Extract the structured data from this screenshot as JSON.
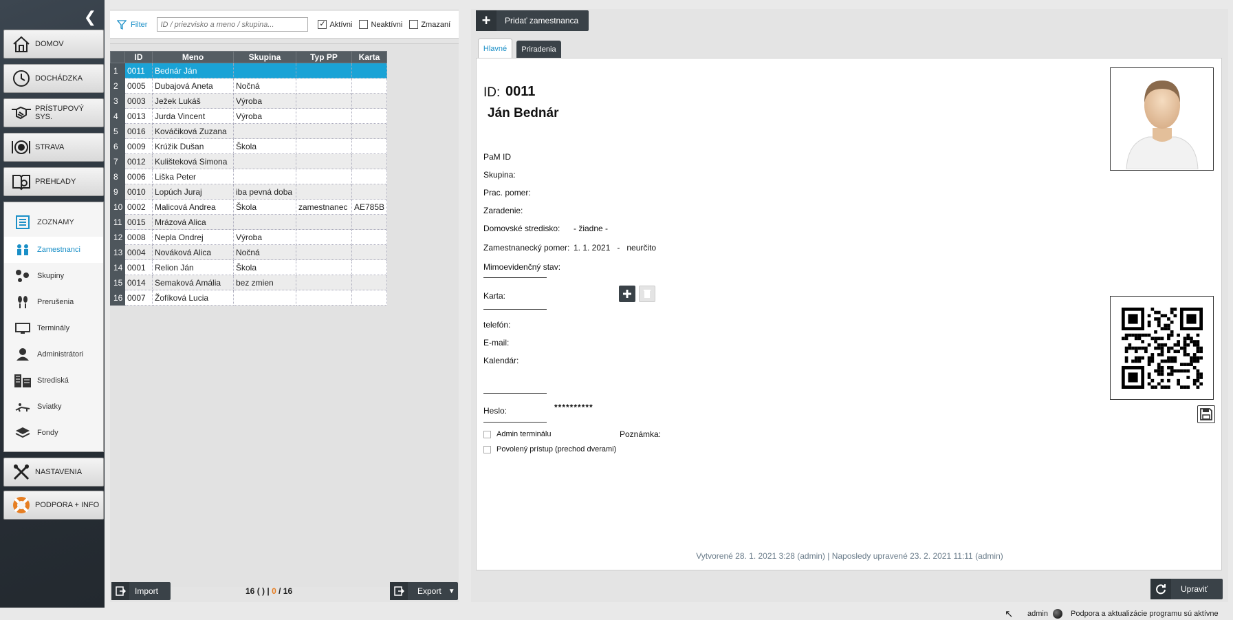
{
  "sidebar": {
    "collapse_glyph": "❮",
    "menu": [
      {
        "label": "DOMOV",
        "icon": "home-icon"
      },
      {
        "label": "DOCHÁDZKA",
        "icon": "clock-icon"
      },
      {
        "label": "PRÍSTUPOVÝ SYS.",
        "icon": "handshake-icon"
      },
      {
        "label": "STRAVA",
        "icon": "plate-icon"
      },
      {
        "label": "PREHĽADY",
        "icon": "report-book-icon"
      }
    ],
    "submenu_header": "ZOZNAMY",
    "submenu": [
      {
        "label": "Zamestnanci",
        "icon": "people-icon"
      },
      {
        "label": "Skupiny",
        "icon": "group-icon"
      },
      {
        "label": "Prerušenia",
        "icon": "footprints-icon"
      },
      {
        "label": "Terminály",
        "icon": "terminal-icon"
      },
      {
        "label": "Administrátori",
        "icon": "admin-icon"
      },
      {
        "label": "Strediská",
        "icon": "buildings-icon"
      },
      {
        "label": "Sviatky",
        "icon": "holiday-icon"
      },
      {
        "label": "Fondy",
        "icon": "layers-icon"
      }
    ],
    "bottom": [
      {
        "label": "NASTAVENIA",
        "icon": "tools-icon"
      },
      {
        "label": "PODPORA + INFO",
        "icon": "lifebuoy-icon"
      }
    ]
  },
  "filter": {
    "label": "Filter",
    "placeholder": "ID / priezvisko a meno / skupina...",
    "active_label": "Aktívni",
    "active_checked": "✓",
    "inactive_label": "Neaktívni",
    "deleted_label": "Zmazaní"
  },
  "table": {
    "columns": [
      "ID",
      "Meno",
      "Skupina",
      "Typ PP",
      "Karta"
    ],
    "rows": [
      [
        "1",
        "0011",
        "Bednár Ján",
        "",
        "",
        ""
      ],
      [
        "2",
        "0005",
        "Dubajová Aneta",
        "Nočná",
        "",
        ""
      ],
      [
        "3",
        "0003",
        "Ježek Lukáš",
        "Výroba",
        "",
        ""
      ],
      [
        "4",
        "0013",
        "Jurda Vincent",
        "Výroba",
        "",
        ""
      ],
      [
        "5",
        "0016",
        "Kováčiková Zuzana",
        "",
        "",
        ""
      ],
      [
        "6",
        "0009",
        "Krúžik Dušan",
        "Škola",
        "",
        ""
      ],
      [
        "7",
        "0012",
        "Kulišteková Simona",
        "",
        "",
        ""
      ],
      [
        "8",
        "0006",
        "Liška Peter",
        "",
        "",
        ""
      ],
      [
        "9",
        "0010",
        "Lopúch Juraj",
        "iba pevná doba",
        "",
        ""
      ],
      [
        "10",
        "0002",
        "Malicová Andrea",
        "Škola",
        "zamestnanec",
        "AE785B"
      ],
      [
        "11",
        "0015",
        "Mrázová Alica",
        "",
        "",
        ""
      ],
      [
        "12",
        "0008",
        "Nepla Ondrej",
        "Výroba",
        "",
        ""
      ],
      [
        "13",
        "0004",
        "Nováková Alica",
        "Nočná",
        "",
        ""
      ],
      [
        "14",
        "0001",
        "Relion Ján",
        "Škola",
        "",
        ""
      ],
      [
        "15",
        "0014",
        "Semaková Amália",
        "bez zmien",
        "",
        ""
      ],
      [
        "16",
        "0007",
        "Žofíková Lucia",
        "",
        "",
        ""
      ]
    ]
  },
  "bottom_bar": {
    "import_label": "Import",
    "count_total": "16",
    "count_open": " ( ",
    "count_close": " ) | ",
    "count_selected": "0",
    "count_sep": " / ",
    "count_of": "16",
    "export_label": "Export"
  },
  "detail": {
    "add_label": "Pridať zamestnanca",
    "tabs": [
      "Hlavné",
      "Priradenia"
    ],
    "id_label": "ID:",
    "id_value": "0011",
    "name": "Ján Bednár",
    "fields": {
      "pam_id": "PaM ID",
      "skupina": "Skupina:",
      "prac_pomer": "Prac. pomer:",
      "zaradenie": "Zaradenie:",
      "stredisko_label": "Domovské stredisko:",
      "stredisko_value": "- žiadne -",
      "zam_pomer_label": "Zamestnanecký pomer:",
      "zam_pomer_value": "1. 1. 2021   -   neurčito",
      "mimoevid": "Mimoevidenčný stav:",
      "karta": "Karta:",
      "telefon": "telefón:",
      "email": "E-mail:",
      "kalendar": "Kalendár:",
      "heslo": "Heslo:",
      "heslo_value": "**********",
      "admin_term": "Admin terminálu",
      "povoleny": "Povolený prístup (prechod dverami)",
      "poznamka": "Poznámka:"
    },
    "footer": "Vytvorené 28. 1. 2021 3:28 (admin) | Naposledy upravené 23. 2. 2021 11:11 (admin)",
    "edit_label": "Upraviť"
  },
  "status": {
    "user": "admin",
    "message": "Podpora a aktualizácie programu sú aktívne"
  }
}
